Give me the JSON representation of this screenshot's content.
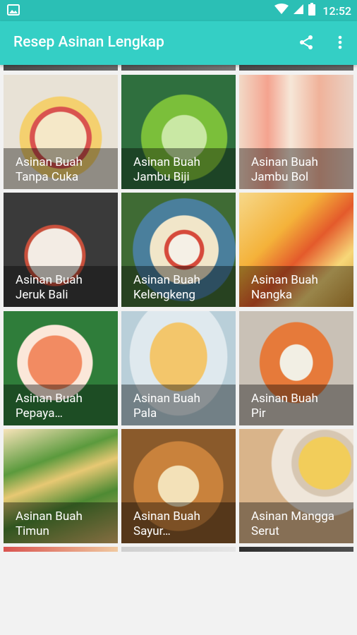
{
  "status_bar": {
    "time": "12:52"
  },
  "app_bar": {
    "title": "Resep Asinan Lengkap"
  },
  "colors": {
    "status_bar": "#2bbfb5",
    "app_bar": "#34cfc5",
    "background": "#f2f2f2"
  },
  "icons": [
    "image-icon",
    "wifi-icon",
    "signal-icon",
    "battery-icon",
    "share-icon",
    "more-vert-icon"
  ],
  "recipes": [
    {
      "label": "Asinan Buah\nTanpa Cuka"
    },
    {
      "label": "Asinan Buah\nJambu Biji"
    },
    {
      "label": "Asinan Buah\nJambu Bol"
    },
    {
      "label": "Asinan Buah\nJeruk Bali"
    },
    {
      "label": "Asinan Buah\nKelengkeng"
    },
    {
      "label": "Asinan Buah\nNangka"
    },
    {
      "label": "Asinan Buah\nPepaya…"
    },
    {
      "label": "Asinan Buah\nPala"
    },
    {
      "label": "Asinan Buah\nPir"
    },
    {
      "label": "Asinan Buah\nTimun"
    },
    {
      "label": "Asinan Buah\nSayur…"
    },
    {
      "label": "Asinan Mangga\nSerut"
    }
  ]
}
